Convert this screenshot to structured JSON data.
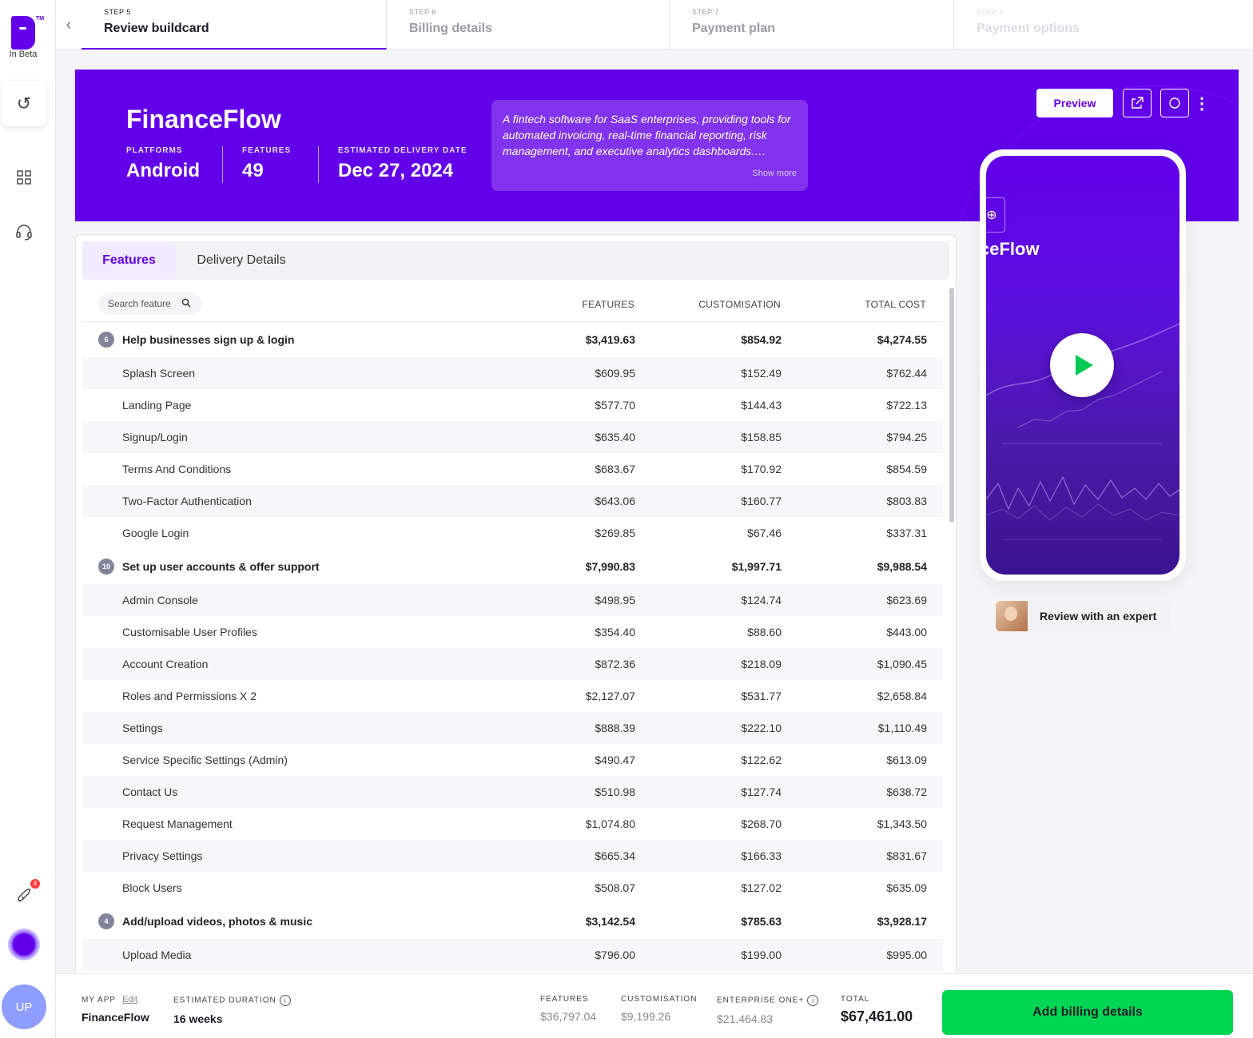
{
  "brand": {
    "inbeta": "In Beta",
    "tm": "TM"
  },
  "sidebar": {
    "rocket_badge": "4",
    "avatar_initials": "UP"
  },
  "steps": [
    {
      "label": "STEP 5",
      "title": "Review buildcard"
    },
    {
      "label": "STEP 6",
      "title": "Billing details"
    },
    {
      "label": "STEP 7",
      "title": "Payment plan"
    },
    {
      "label": "STEP 8",
      "title": "Payment options"
    }
  ],
  "hero": {
    "app_name": "FinanceFlow",
    "platforms_label": "PLATFORMS",
    "platforms_value": "Android",
    "features_label": "FEATURES",
    "features_value": "49",
    "delivery_label": "ESTIMATED DELIVERY DATE",
    "delivery_value": "Dec 27, 2024",
    "description": "A fintech software for SaaS enterprises, providing tools for automated invoicing, real-time financial reporting, risk management, and executive analytics dashboards.…",
    "show_more": "Show more",
    "preview_label": "Preview"
  },
  "tabs": {
    "features": "Features",
    "delivery": "Delivery Details"
  },
  "table": {
    "search_placeholder": "Search feature",
    "col_features": "FEATURES",
    "col_customisation": "CUSTOMISATION",
    "col_total": "TOTAL COST",
    "rows": [
      {
        "group": true,
        "count": "6",
        "name": "Help businesses sign up & login",
        "features": "$3,419.63",
        "custom": "$854.92",
        "total": "$4,274.55"
      },
      {
        "name": "Splash Screen",
        "features": "$609.95",
        "custom": "$152.49",
        "total": "$762.44"
      },
      {
        "name": "Landing Page",
        "features": "$577.70",
        "custom": "$144.43",
        "total": "$722.13"
      },
      {
        "name": "Signup/Login",
        "features": "$635.40",
        "custom": "$158.85",
        "total": "$794.25"
      },
      {
        "name": "Terms And Conditions",
        "features": "$683.67",
        "custom": "$170.92",
        "total": "$854.59"
      },
      {
        "name": "Two-Factor Authentication",
        "features": "$643.06",
        "custom": "$160.77",
        "total": "$803.83"
      },
      {
        "name": "Google Login",
        "features": "$269.85",
        "custom": "$67.46",
        "total": "$337.31"
      },
      {
        "group": true,
        "count": "10",
        "name": "Set up user accounts & offer support",
        "features": "$7,990.83",
        "custom": "$1,997.71",
        "total": "$9,988.54"
      },
      {
        "name": "Admin Console",
        "features": "$498.95",
        "custom": "$124.74",
        "total": "$623.69"
      },
      {
        "name": "Customisable User Profiles",
        "features": "$354.40",
        "custom": "$88.60",
        "total": "$443.00"
      },
      {
        "name": "Account Creation",
        "features": "$872.36",
        "custom": "$218.09",
        "total": "$1,090.45"
      },
      {
        "name": "Roles and Permissions X 2",
        "features": "$2,127.07",
        "custom": "$531.77",
        "total": "$2,658.84"
      },
      {
        "name": "Settings",
        "features": "$888.39",
        "custom": "$222.10",
        "total": "$1,110.49"
      },
      {
        "name": "Service Specific Settings (Admin)",
        "features": "$490.47",
        "custom": "$122.62",
        "total": "$613.09"
      },
      {
        "name": "Contact Us",
        "features": "$510.98",
        "custom": "$127.74",
        "total": "$638.72"
      },
      {
        "name": "Request Management",
        "features": "$1,074.80",
        "custom": "$268.70",
        "total": "$1,343.50"
      },
      {
        "name": "Privacy Settings",
        "features": "$665.34",
        "custom": "$166.33",
        "total": "$831.67"
      },
      {
        "name": "Block Users",
        "features": "$508.07",
        "custom": "$127.02",
        "total": "$635.09"
      },
      {
        "group": true,
        "count": "4",
        "name": "Add/upload videos, photos & music",
        "features": "$3,142.54",
        "custom": "$785.63",
        "total": "$3,928.17"
      },
      {
        "name": "Upload Media",
        "features": "$796.00",
        "custom": "$199.00",
        "total": "$995.00"
      }
    ]
  },
  "phone": {
    "title": "ceFlow"
  },
  "expert": {
    "label": "Review with an expert"
  },
  "footer": {
    "myapp_label": "MY APP",
    "edit_label": "Edit",
    "myapp_value": "FinanceFlow",
    "duration_label": "ESTIMATED DURATION",
    "duration_value": "16 weeks",
    "features_label": "FEATURES",
    "features_value": "$36,797.04",
    "custom_label": "CUSTOMISATION",
    "custom_value": "$9,199.26",
    "enterprise_label": "ENTERPRISE ONE+",
    "enterprise_value": "$21,464.83",
    "total_label": "TOTAL",
    "total_value": "$67,461.00",
    "cta": "Add billing details"
  },
  "colors": {
    "brand": "#6200ea",
    "cta": "#00d653"
  }
}
